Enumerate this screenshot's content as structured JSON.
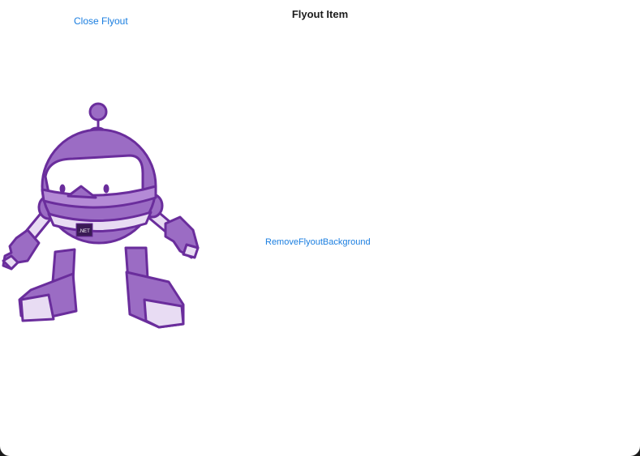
{
  "window": {
    "title": "Flyout Item"
  },
  "flyout": {
    "close_label": "Close Flyout"
  },
  "content": {
    "remove_background_label": "RemoveFlyoutBackground",
    "image_icon": "dotnet-bot-icon",
    "badge_text": ".NET"
  },
  "colors": {
    "accent": "#1a7ee0",
    "bot_primary": "#9b6cc4",
    "bot_outline": "#6a2d9c",
    "bot_light": "#e8dcf3"
  }
}
